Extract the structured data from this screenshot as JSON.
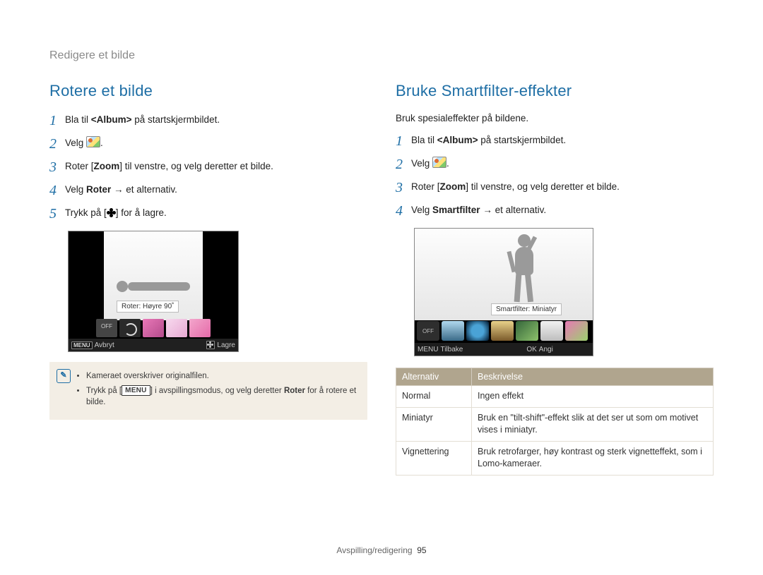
{
  "breadcrumb": "Redigere et bilde",
  "left": {
    "heading": "Rotere et bilde",
    "steps": [
      {
        "n": "1",
        "pre": "Bla til ",
        "bold": "<Album>",
        "post": " på startskjermbildet."
      },
      {
        "n": "2",
        "pre": "Velg ",
        "icon": "palette",
        "post": "."
      },
      {
        "n": "3",
        "pre": "Roter [",
        "bold": "Zoom",
        "post": "] til venstre, og velg deretter et bilde."
      },
      {
        "n": "4",
        "pre": "Velg ",
        "bold": "Roter",
        "post": " → et alternativ."
      },
      {
        "n": "5",
        "pre": "Trykk på [",
        "icon": "flower",
        "post": "] for å lagre."
      }
    ],
    "lcd": {
      "tooltip": "Roter: Høyre 90˚",
      "menu_label": "MENU",
      "left_action": "Avbryt",
      "right_action": "Lagre"
    },
    "note": {
      "b1": "Kameraet overskriver originalfilen.",
      "b2_pre": "Trykk på [",
      "b2_kbd": "MENU",
      "b2_mid": "] i avspillingsmodus, og velg deretter ",
      "b2_bold": "Roter",
      "b2_post": " for å rotere et bilde."
    }
  },
  "right": {
    "heading": "Bruke Smartfilter-effekter",
    "intro": "Bruk spesialeffekter på bildene.",
    "steps": [
      {
        "n": "1",
        "pre": "Bla til ",
        "bold": "<Album>",
        "post": " på startskjermbildet."
      },
      {
        "n": "2",
        "pre": "Velg ",
        "icon": "palette",
        "post": "."
      },
      {
        "n": "3",
        "pre": "Roter [",
        "bold": "Zoom",
        "post": "] til venstre, og velg deretter et bilde."
      },
      {
        "n": "4",
        "pre": "Velg ",
        "bold": "Smartfilter",
        "post": " → et alternativ."
      }
    ],
    "lcd": {
      "tooltip": "Smartfilter: Miniatyr",
      "menu_label": "MENU",
      "ok_label": "OK",
      "left_action": "Tilbake",
      "right_action": "Angi"
    },
    "table": {
      "col1": "Alternativ",
      "col2": "Beskrivelse",
      "rows": [
        {
          "k": "Normal",
          "v": "Ingen effekt"
        },
        {
          "k": "Miniatyr",
          "v": "Bruk en \"tilt-shift\"-effekt slik at det ser ut som om motivet vises i miniatyr."
        },
        {
          "k": "Vignettering",
          "v": "Bruk retrofarger, høy kontrast og sterk vignetteffekt, som i Lomo-kameraer."
        }
      ]
    }
  },
  "footer": {
    "section": "Avspilling/redigering",
    "page": "95"
  }
}
